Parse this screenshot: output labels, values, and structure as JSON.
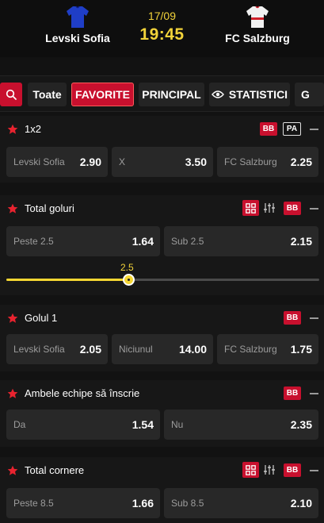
{
  "match": {
    "date": "17/09",
    "time": "19:45",
    "home_team": "Levski Sofia",
    "away_team": "FC Salzburg",
    "home_jersey_color": "#1f3ec7",
    "away_jersey_color": "#f1f1f1",
    "away_jersey_trim": "#d0202a"
  },
  "tabs": [
    {
      "label": "Toate",
      "active": false
    },
    {
      "label": "FAVORITE",
      "active": true
    },
    {
      "label": "PRINCIPAL",
      "active": false
    },
    {
      "label": "STATISTICI",
      "active": false,
      "icon": "eye-icon"
    },
    {
      "label": "G",
      "active": false
    }
  ],
  "badges": {
    "bet_builder": "BB",
    "pa": "PA"
  },
  "markets": [
    {
      "title": "1x2",
      "odds": [
        {
          "label": "Levski Sofia",
          "value": "2.90"
        },
        {
          "label": "X",
          "value": "3.50"
        },
        {
          "label": "FC Salzburg",
          "value": "2.25"
        }
      ]
    },
    {
      "title": "Total goluri",
      "odds": [
        {
          "label": "Peste 2.5",
          "value": "1.64"
        },
        {
          "label": "Sub 2.5",
          "value": "2.15"
        }
      ],
      "slider": {
        "value": "2.5",
        "position_fraction": 0.39
      }
    },
    {
      "title": "Golul 1",
      "odds": [
        {
          "label": "Levski Sofia",
          "value": "2.05"
        },
        {
          "label": "Niciunul",
          "value": "14.00"
        },
        {
          "label": "FC Salzburg",
          "value": "1.75"
        }
      ]
    },
    {
      "title": "Ambele echipe să înscrie",
      "odds": [
        {
          "label": "Da",
          "value": "1.54"
        },
        {
          "label": "Nu",
          "value": "2.35"
        }
      ]
    },
    {
      "title": "Total cornere",
      "odds": [
        {
          "label": "Peste 8.5",
          "value": "1.66"
        },
        {
          "label": "Sub 8.5",
          "value": "2.10"
        }
      ]
    }
  ],
  "colors": {
    "accent_red": "#c8102e",
    "accent_yellow": "#f2d33a",
    "background": "#121212",
    "card": "#171717",
    "odd_cell": "#282828"
  }
}
